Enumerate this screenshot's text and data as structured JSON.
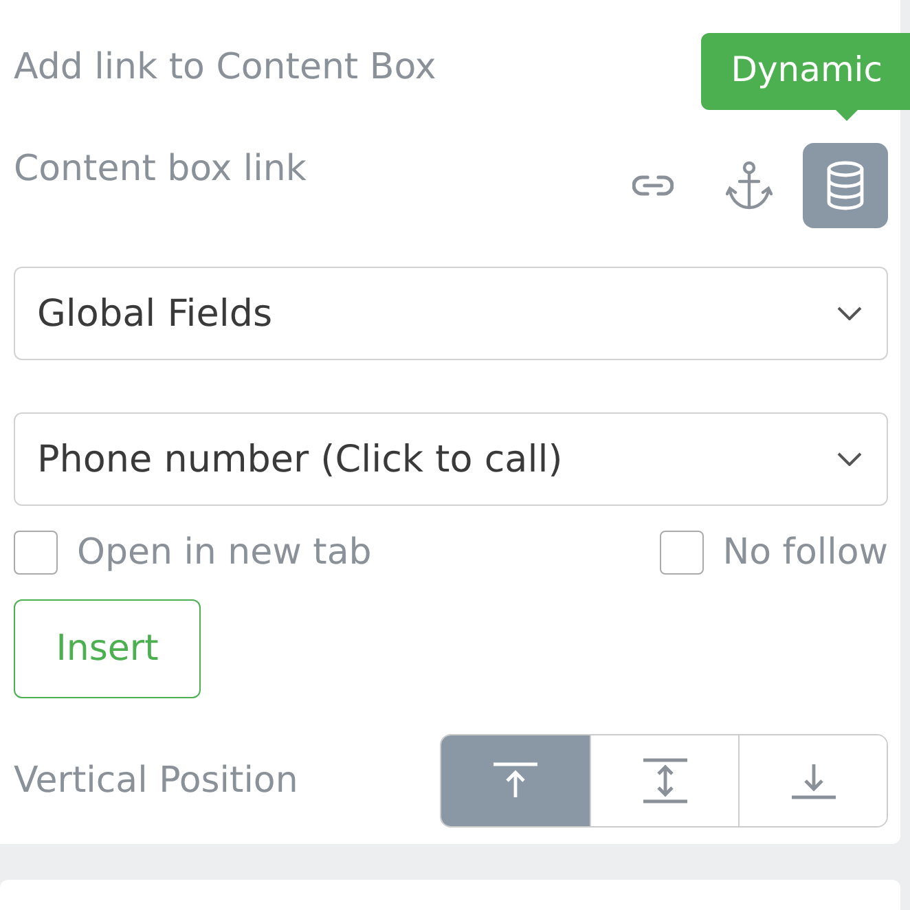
{
  "heading": "Add link to Content Box",
  "tooltip": "Dynamic",
  "link_label": "Content box link",
  "link_types": [
    {
      "kind": "link",
      "selected": false
    },
    {
      "kind": "anchor",
      "selected": false
    },
    {
      "kind": "database",
      "selected": true
    }
  ],
  "dropdowns": [
    {
      "value": "Global Fields"
    },
    {
      "value": "Phone number (Click to call)"
    }
  ],
  "checkboxes": [
    {
      "label": "Open in new tab",
      "checked": false
    },
    {
      "label": "No follow",
      "checked": false
    }
  ],
  "insert_button": "Insert",
  "vertical_position": {
    "label": "Vertical Position",
    "options": [
      {
        "kind": "top",
        "selected": true
      },
      {
        "kind": "middle",
        "selected": false
      },
      {
        "kind": "bottom",
        "selected": false
      }
    ]
  }
}
